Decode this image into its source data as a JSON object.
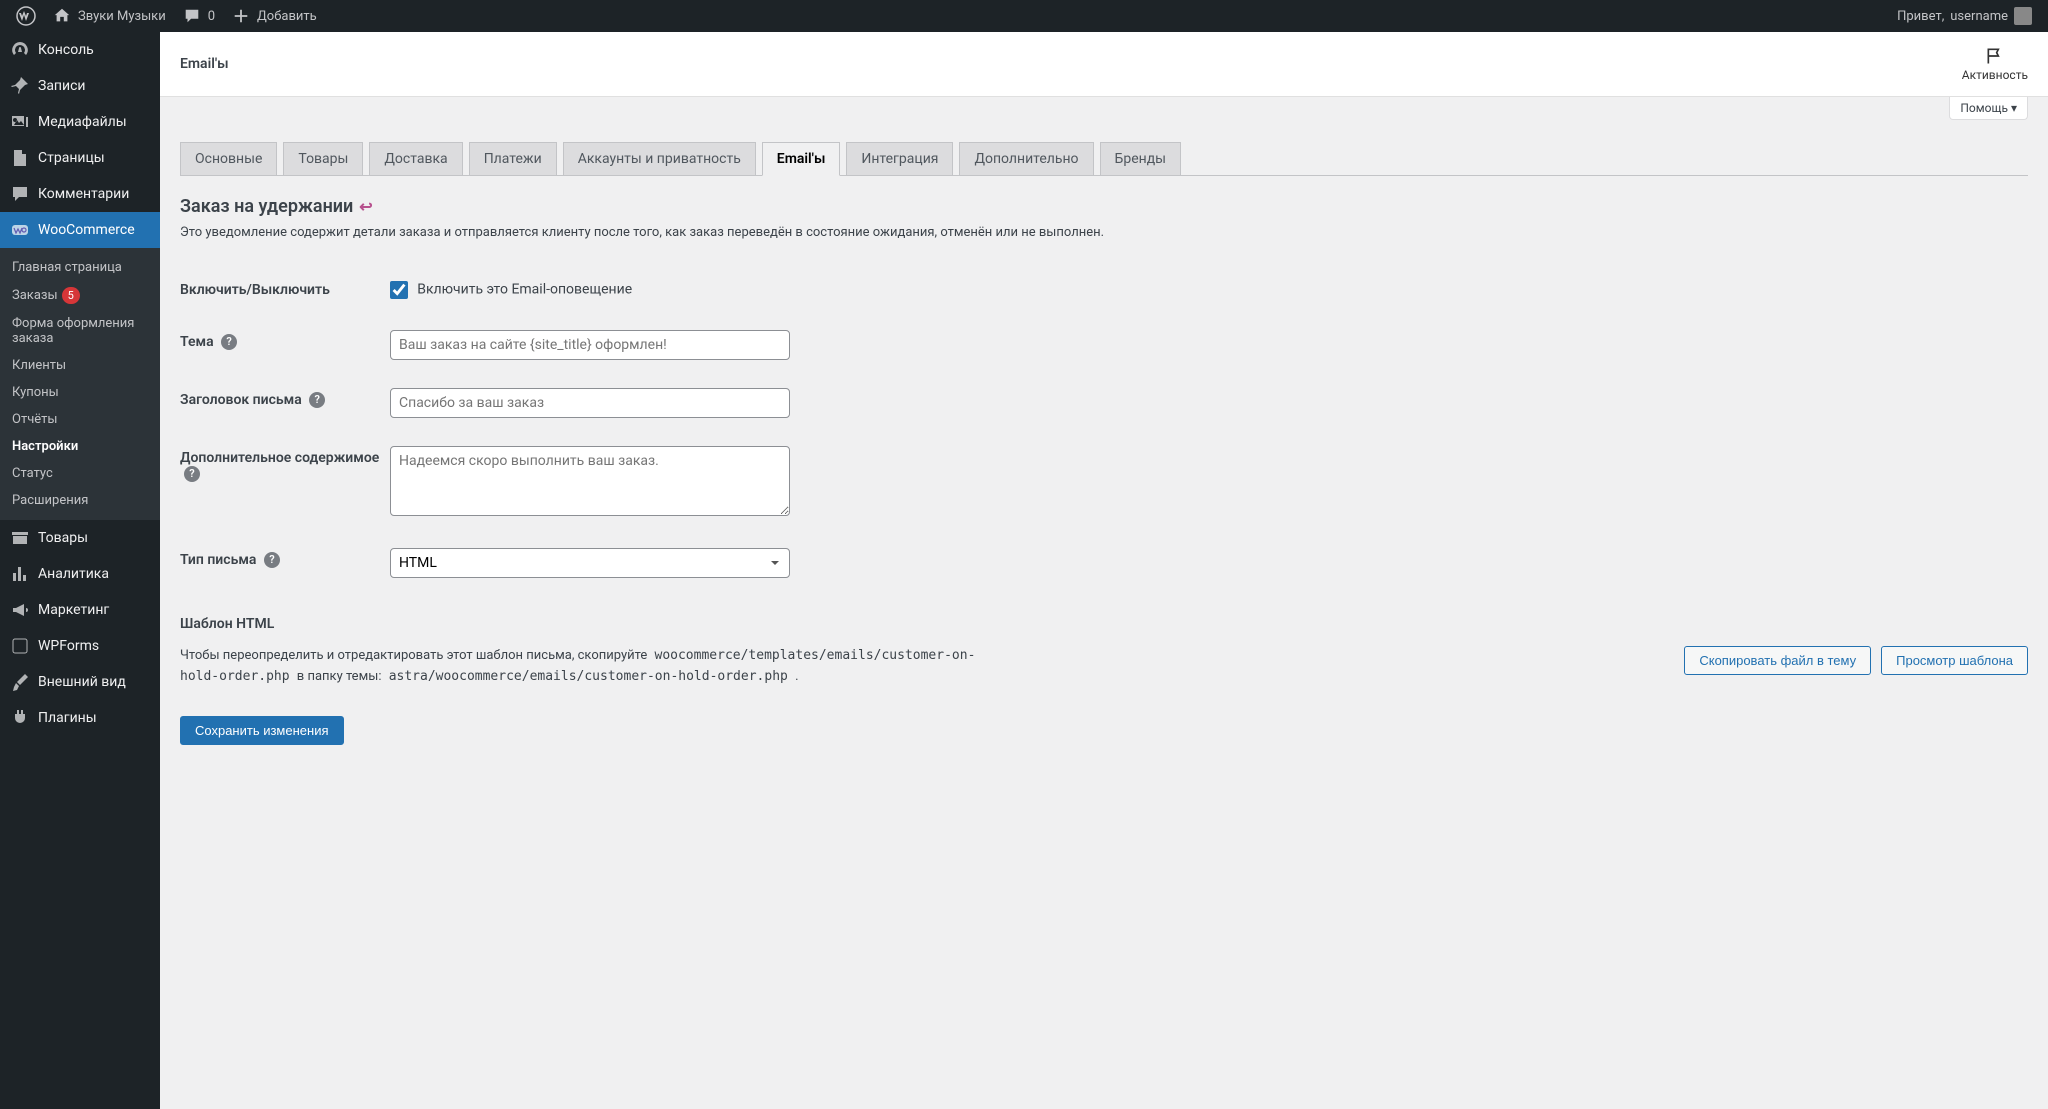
{
  "adminbar": {
    "site_name": "Звуки Музыки",
    "comments_count": "0",
    "add_new": "Добавить",
    "greeting_prefix": "Привет, ",
    "username": "username"
  },
  "sidebar": {
    "items": [
      {
        "label": "Консоль"
      },
      {
        "label": "Записи"
      },
      {
        "label": "Медиафайлы"
      },
      {
        "label": "Страницы"
      },
      {
        "label": "Комментарии"
      },
      {
        "label": "WooCommerce"
      },
      {
        "label": "Товары"
      },
      {
        "label": "Аналитика"
      },
      {
        "label": "Маркетинг"
      },
      {
        "label": "WPForms"
      },
      {
        "label": "Внешний вид"
      },
      {
        "label": "Плагины"
      }
    ],
    "woo_submenu": [
      {
        "label": "Главная страница"
      },
      {
        "label": "Заказы",
        "badge": "5"
      },
      {
        "label": "Форма оформления заказа"
      },
      {
        "label": "Клиенты"
      },
      {
        "label": "Купоны"
      },
      {
        "label": "Отчёты"
      },
      {
        "label": "Настройки"
      },
      {
        "label": "Статус"
      },
      {
        "label": "Расширения"
      }
    ]
  },
  "topbar": {
    "title": "Email'ы",
    "activity": "Активность"
  },
  "help_label": "Помощь",
  "tabs": [
    "Основные",
    "Товары",
    "Доставка",
    "Платежи",
    "Аккаунты и приватность",
    "Email'ы",
    "Интеграция",
    "Дополнительно",
    "Бренды"
  ],
  "active_tab_index": 5,
  "section": {
    "title": "Заказ на удержании",
    "back_icon": "↩",
    "desc": "Это уведомление содержит детали заказа и отправляется клиенту после того, как заказ переведён в состояние ожидания, отменён или не выполнен."
  },
  "form": {
    "enable_label": "Включить/Выключить",
    "enable_checkbox": "Включить это Email-оповещение",
    "subject_label": "Тема",
    "subject_placeholder": "Ваш заказ на сайте {site_title} оформлен!",
    "heading_label": "Заголовок письма",
    "heading_placeholder": "Спасибо за ваш заказ",
    "additional_label": "Дополнительное содержимое",
    "additional_placeholder": "Надеемся скоро выполнить ваш заказ.",
    "type_label": "Тип письма",
    "type_selected": "HTML"
  },
  "template": {
    "title": "Шаблон HTML",
    "desc_prefix": "Чтобы переопределить и отредактировать этот шаблон письма, скопируйте ",
    "code1": "woocommerce/templates/emails/customer-on-hold-order.php",
    "desc_middle": " в папку темы: ",
    "code2": "astra/woocommerce/emails/customer-on-hold-order.php",
    "desc_suffix": " .",
    "copy_btn": "Скопировать файл в тему",
    "view_btn": "Просмотр шаблона"
  },
  "save_btn": "Сохранить изменения"
}
